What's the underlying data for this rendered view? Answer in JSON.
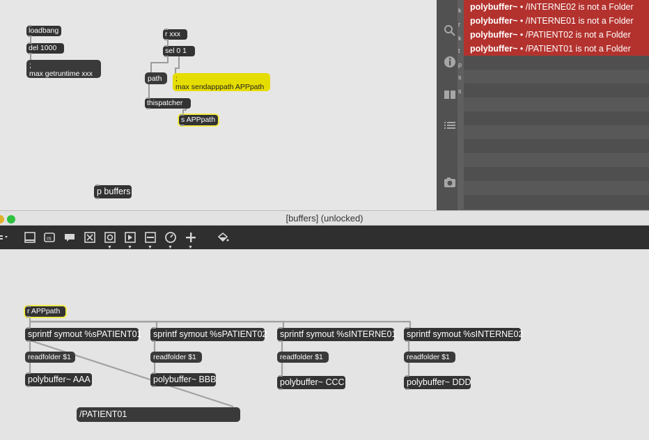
{
  "upper_patch": {
    "objects": {
      "loadbang": "loadbang",
      "del": "del 1000",
      "getruntime_msg": ";\nmax getruntime xxx",
      "r_xxx": "r xxx",
      "sel": "sel 0 1",
      "path_msg": "path",
      "sendapppath_msg": ";\nmax sendapppath APPpath",
      "thispatcher": "thispatcher",
      "s_apppath": "s APPpath",
      "p_buffers": "p buffers"
    }
  },
  "console": {
    "messages": [
      {
        "source": "polybuffer~",
        "text": "• /INTERNE02 is not a Folder"
      },
      {
        "source": "polybuffer~",
        "text": "• /INTERNE01 is not a Folder"
      },
      {
        "source": "polybuffer~",
        "text": "• /PATIENT02 is not a Folder"
      },
      {
        "source": "polybuffer~",
        "text": "• /PATIENT01 is not a Folder"
      }
    ],
    "sidebar_icons": [
      "search-icon",
      "info-icon",
      "reference-icon",
      "list-icon",
      "snapshot-icon"
    ]
  },
  "window": {
    "title": "[buffers] (unlocked)"
  },
  "toolbar": {
    "tools": [
      "presentation-icon",
      "message-icon",
      "comment-icon",
      "button-icon",
      "toggle-icon",
      "number-icon",
      "slider-icon",
      "dial-icon",
      "add-icon",
      "format-icon"
    ]
  },
  "lower_patch": {
    "r_apppath": "r APPpath",
    "columns": [
      {
        "sprintf": "sprintf symout %sPATIENT01",
        "readfolder": "readfolder $1",
        "polybuffer": "polybuffer~ AAA"
      },
      {
        "sprintf": "sprintf symout %sPATIENT02",
        "readfolder": "readfolder $1",
        "polybuffer": "polybuffer~ BBB"
      },
      {
        "sprintf": "sprintf symout %sINTERNE01",
        "readfolder": "readfolder $1",
        "polybuffer": "polybuffer~ CCC"
      },
      {
        "sprintf": "sprintf symout %sINTERNE02",
        "readfolder": "readfolder $1",
        "polybuffer": "polybuffer~ DDD"
      }
    ],
    "result_msg": "/PATIENT01"
  },
  "colors": {
    "error_bg": "#b3322e",
    "object_bg": "#333333",
    "message_highlight": "#e6dd00",
    "traffic_yellow": "#e0b22a",
    "traffic_green": "#2dc23f"
  }
}
